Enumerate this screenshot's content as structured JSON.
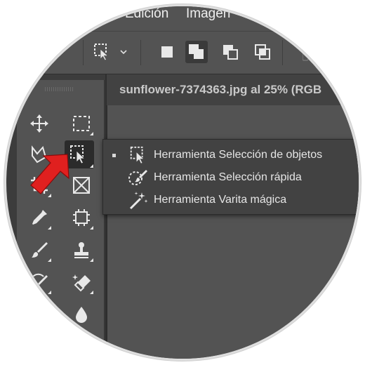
{
  "menubar": {
    "items": [
      "Edición",
      "Imagen"
    ]
  },
  "document": {
    "tab_title": "sunflower-7374363.jpg al 25% (RGB"
  },
  "flyout": {
    "items": [
      {
        "label": "Herramienta Selección de objetos",
        "icon": "object-selection-icon",
        "active": true
      },
      {
        "label": "Herramienta Selección rápida",
        "icon": "quick-selection-icon",
        "active": false
      },
      {
        "label": "Herramienta Varita mágica",
        "icon": "magic-wand-icon",
        "active": false
      }
    ]
  },
  "toolbar": {
    "tools": [
      "move-icon",
      "marquee-icon",
      "lasso-icon",
      "object-selection-icon",
      "crop-icon",
      "frame-icon",
      "eyedropper-icon",
      "spot-healing-icon",
      "brush-icon",
      "stamp-icon",
      "history-brush-icon",
      "eraser-icon",
      "blur-icon"
    ]
  },
  "colors": {
    "panel": "#535353",
    "dark": "#3c3c3c",
    "accent_arrow": "#e0201f"
  }
}
